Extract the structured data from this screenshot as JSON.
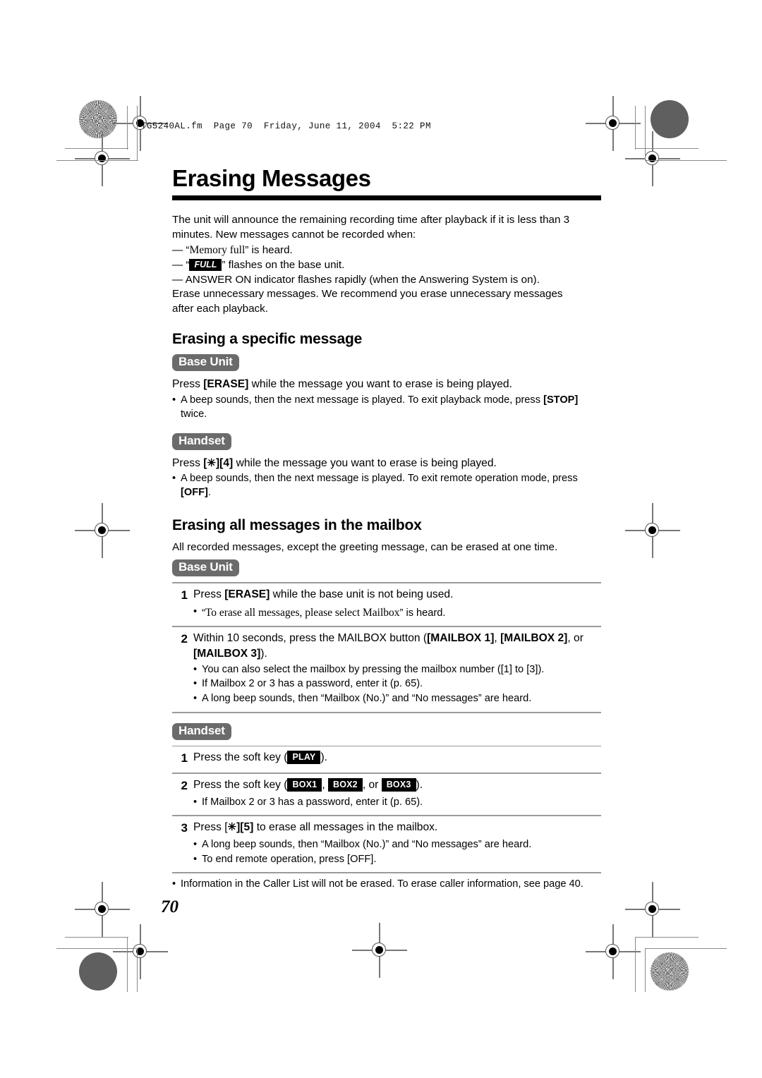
{
  "header": {
    "filename_line": "TG5240AL.fm  Page 70  Friday, June 11, 2004  5:22 PM"
  },
  "page_number": "70",
  "title": "Erasing Messages",
  "intro": {
    "line1": "The unit will announce the remaining recording time after playback if it is less than 3",
    "line2": "minutes. New messages cannot be recorded when:",
    "dash1_prefix": "— “",
    "dash1_serif": "Memory full",
    "dash1_suffix": "” is heard.",
    "dash2_prefix": "— “",
    "dash2_badge": "FULL",
    "dash2_suffix": "” flashes on the base unit.",
    "dash3": "— ANSWER ON indicator flashes rapidly (when the Answering System is on).",
    "line3": "Erase unnecessary messages. We recommend you erase unnecessary messages",
    "line4": "after each playback."
  },
  "section1": {
    "heading": "Erasing a specific message",
    "base_unit": {
      "badge": "Base Unit",
      "instruction_pre": "Press ",
      "instruction_key": "[ERASE]",
      "instruction_post": " while the message you want to erase is being played.",
      "bullets": [
        {
          "pre": "A beep sounds, then the next message is played. To exit playback mode, press ",
          "key": "[STOP]",
          "post": " twice."
        }
      ]
    },
    "handset": {
      "badge": "Handset",
      "instruction_pre": "Press ",
      "instruction_key1": "[",
      "instruction_star": "✳",
      "instruction_key2": "][4]",
      "instruction_post": " while the message you want to erase is being played.",
      "bullets": [
        {
          "pre": "A beep sounds, then the next message is played. To exit remote operation mode, press ",
          "key": "[OFF]",
          "post": "."
        }
      ]
    }
  },
  "section2": {
    "heading": "Erasing all messages in the mailbox",
    "lead": "All recorded messages, except the greeting message, can be erased at one time.",
    "base_unit": {
      "badge": "Base Unit",
      "steps": [
        {
          "num": "1",
          "text_pre": "Press ",
          "text_key": "[ERASE]",
          "text_post": " while the base unit is not being used.",
          "bullets_serif": [
            {
              "pre": "“",
              "serif": "To erase all messages, please select Mailbox",
              "post": "” is heard."
            }
          ]
        },
        {
          "num": "2",
          "text_pre": "Within 10 seconds, press the MAILBOX button (",
          "key1": "[MAILBOX 1]",
          "mid1": ", ",
          "key2": "[MAILBOX 2]",
          "mid2": ", or ",
          "key3": "[MAILBOX 3]",
          "text_post": ").",
          "bullets": [
            "You can also select the mailbox by pressing the mailbox number ([1] to [3]).",
            "If Mailbox 2 or 3 has a password, enter it (p. 65).",
            "A long beep sounds, then “Mailbox (No.)” and “No messages” are heard."
          ]
        }
      ]
    },
    "handset": {
      "badge": "Handset",
      "steps": [
        {
          "num": "1",
          "text_pre": "Press the soft key (",
          "softkeys": [
            "PLAY"
          ],
          "text_post": ")."
        },
        {
          "num": "2",
          "text_pre": "Press the soft key (",
          "softkeys": [
            "BOX1",
            "BOX2",
            "BOX3"
          ],
          "text_mid": ", ",
          "text_or": ", or ",
          "text_post": ").",
          "bullets": [
            "If Mailbox 2 or 3 has a password, enter it (p. 65)."
          ]
        },
        {
          "num": "3",
          "text_pre": "Press [",
          "star": "✳",
          "text_key": "][5]",
          "text_post": " to erase all messages in the mailbox.",
          "bullets": [
            "A long beep sounds, then “Mailbox (No.)” and “No messages” are heard.",
            "To end remote operation, press [OFF]."
          ]
        }
      ]
    },
    "final_note_line1": "Information in the Caller List will not be erased. To erase caller information, see",
    "final_note_line2": "page 40."
  },
  "colors": {
    "badge_gray": "#6b6b6b",
    "rule_black": "#000000",
    "rule_gray": "#9a9a9a"
  }
}
